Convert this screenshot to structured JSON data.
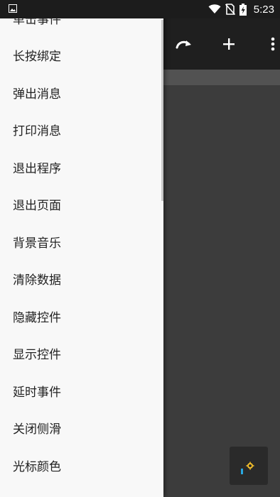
{
  "status_bar": {
    "time": "5:23",
    "icons": [
      "image-icon",
      "wifi-icon",
      "no-sim-icon",
      "battery-charging-icon"
    ]
  },
  "toolbar": {
    "icons": [
      "redo-icon",
      "add-icon",
      "more-vert-icon"
    ]
  },
  "drawer": {
    "items": [
      {
        "label": "单击事件"
      },
      {
        "label": "长按绑定"
      },
      {
        "label": "弹出消息"
      },
      {
        "label": "打印消息"
      },
      {
        "label": "退出程序"
      },
      {
        "label": "退出页面"
      },
      {
        "label": "背景音乐"
      },
      {
        "label": "清除数据"
      },
      {
        "label": "隐藏控件"
      },
      {
        "label": "显示控件"
      },
      {
        "label": "延时事件"
      },
      {
        "label": "关闭侧滑"
      },
      {
        "label": "光标颜色"
      }
    ]
  },
  "colors": {
    "drawer_bg": "#f8f8f8",
    "toolbar_bg": "#1f1f1f",
    "status_bar_bg": "#1c1c1c",
    "widget_yellow": "#f5c02a",
    "widget_blue": "#29a8e0"
  }
}
